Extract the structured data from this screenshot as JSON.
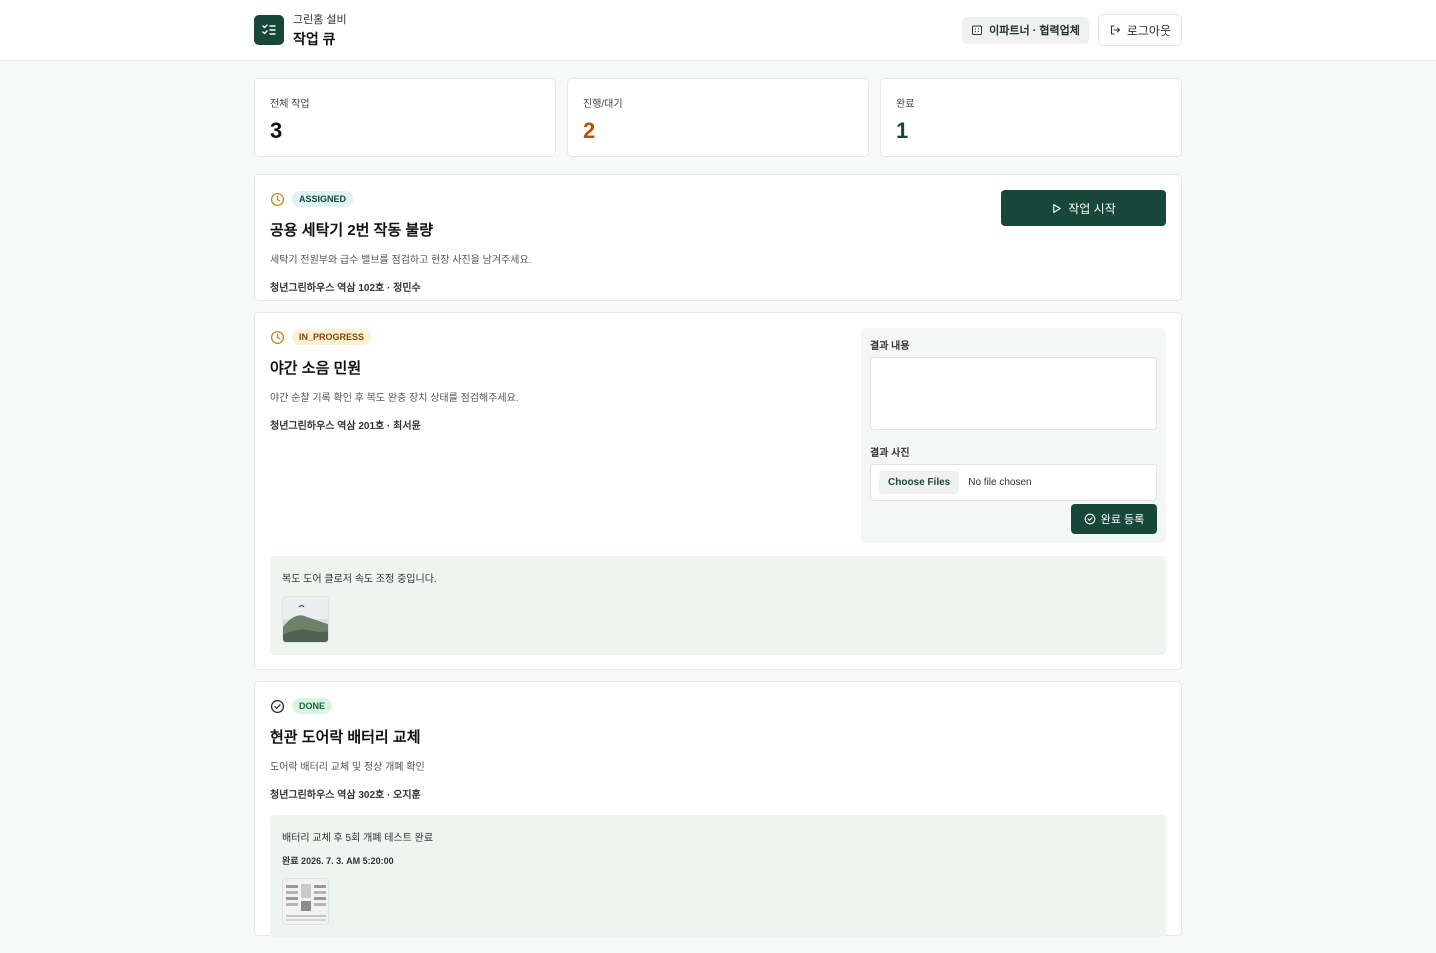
{
  "header": {
    "subtitle": "그린홈 설비",
    "title": "작업 큐",
    "org_chip": "이파트너 · 협력업체",
    "logout": "로그아웃"
  },
  "stats": [
    {
      "label": "전체 작업",
      "value": "3",
      "color": "#111111"
    },
    {
      "label": "진행/대기",
      "value": "2",
      "color": "#b45309"
    },
    {
      "label": "완료",
      "value": "1",
      "color": "#164738"
    }
  ],
  "tasks": [
    {
      "status": "ASSIGNED",
      "title": "공용 세탁기 2번 작동 불량",
      "description": "세탁기 전원부와 급수 밸브를 점검하고 현장 사진을 남겨주세요.",
      "meta": "청년그린하우스 역삼 102호 · 정민수",
      "action": "작업 시작"
    },
    {
      "status": "IN_PROGRESS",
      "title": "야간 소음 민원",
      "description": "야간 순찰 기록 확인 후 복도 완충 장치 상태를 점검해주세요.",
      "meta": "청년그린하우스 역삼 201호 · 최서윤",
      "form": {
        "content_label": "결과 내용",
        "photo_label": "결과 사진",
        "choose_files": "Choose Files",
        "no_file": "No file chosen",
        "submit": "완료 등록"
      },
      "result": {
        "text": "복도 도어 클로저 속도 조정 중입니다."
      }
    },
    {
      "status": "DONE",
      "title": "현관 도어락 배터리 교체",
      "description": "도어락 배터리 교체 및 정상 개폐 확인",
      "meta": "청년그린하우스 역삼 302호 · 오지훈",
      "result": {
        "text": "배터리 교체 후 5회 개폐 테스트 완료",
        "completed": "완료 2026. 7. 3. AM 5:20:00"
      }
    }
  ],
  "colors": {
    "brand": "#164738",
    "clock_icon": "#c7862a"
  }
}
